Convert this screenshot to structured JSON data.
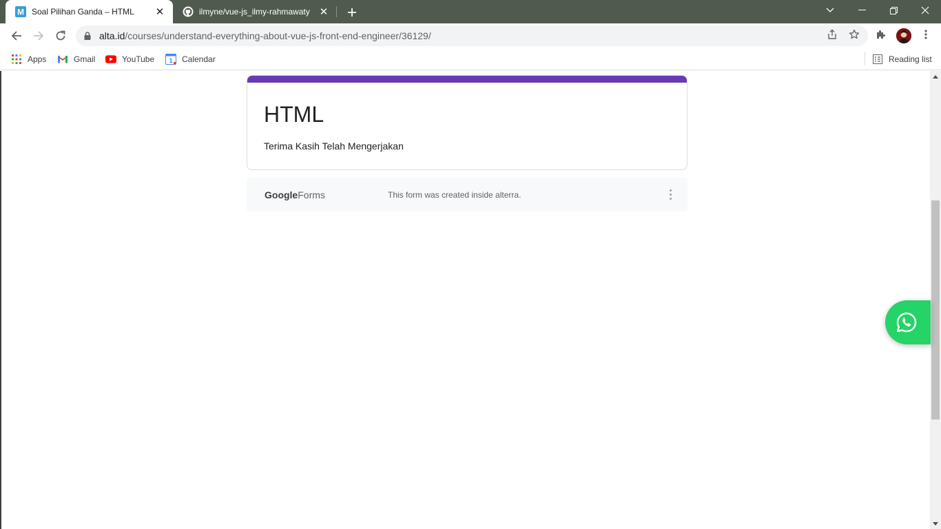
{
  "browser": {
    "tabs": [
      {
        "title": "Soal Pilihan Ganda – HTML",
        "favicon": "M",
        "active": true
      },
      {
        "title": "ilmyne/vue-js_ilmy-rahmawaty",
        "favicon": "github-icon",
        "active": false
      }
    ],
    "new_tab_glyph": "+",
    "close_glyph": "✕",
    "address": {
      "domain": "alta.id",
      "path": "/courses/understand-everything-about-vue-js-front-end-engineer/36129/"
    },
    "bookmarks": [
      {
        "label": "Apps",
        "icon": "apps-grid-icon"
      },
      {
        "label": "Gmail",
        "icon": "gmail-icon"
      },
      {
        "label": "YouTube",
        "icon": "youtube-icon"
      },
      {
        "label": "Calendar",
        "icon": "calendar-icon",
        "icon_text": "1"
      }
    ],
    "reading_list": "Reading list"
  },
  "form": {
    "accent_color": "#673ab7",
    "title": "HTML",
    "message": "Terima Kasih Telah Mengerjakan"
  },
  "footer": {
    "brand_google": "Google",
    "brand_forms": "Forms",
    "created_text": "This form was created inside alterra."
  },
  "colors": {
    "titlebar": "#505a4e",
    "whatsapp": "#25d366"
  }
}
